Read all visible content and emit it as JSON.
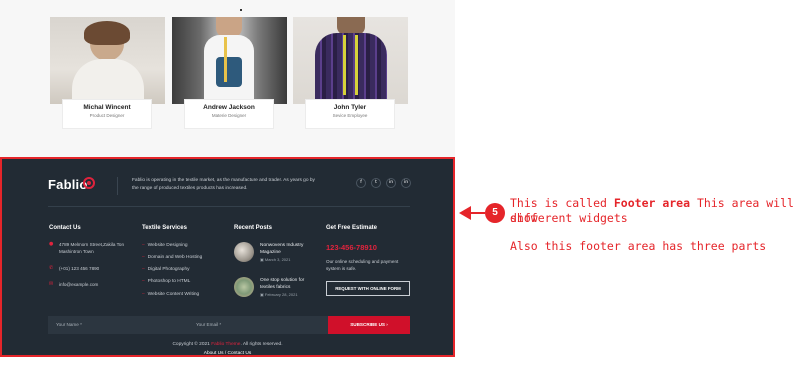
{
  "team": [
    {
      "name": "Michal Wincent",
      "role": "Product Designer"
    },
    {
      "name": "Andrew Jackson",
      "role": "Materie Designer"
    },
    {
      "name": "John Tyler",
      "role": "Sevice Employee"
    }
  ],
  "footer": {
    "logo_text": "Fablio",
    "about": "Fablio is operating in the textile market, as the manufacture and trader. As years go by the range of produced textiles products has increased.",
    "socials": [
      "f",
      "t",
      "in",
      "in"
    ],
    "contact": {
      "title": "Contact Us",
      "address": "4789 Melmorn Street,Zakila Ton Mashintron Town",
      "phone": "(+01) 123 456 7890",
      "email": "info@example.com"
    },
    "services": {
      "title": "Textile Services",
      "items": [
        "Website Designing",
        "Domain and Web Hosting",
        "Digital Photography",
        "Photoshop to HTML",
        "Website Content Writing"
      ]
    },
    "posts": {
      "title": "Recent Posts",
      "items": [
        {
          "title": "Nonwovens Industry Magazine",
          "date": "March 3, 2021"
        },
        {
          "title": "One stop solution for textiles fabrics",
          "date": "February 28, 2021"
        }
      ]
    },
    "estimate": {
      "title": "Get Free Estimate",
      "phone": "123-456-78910",
      "text": "Our online scheduling and payment system is safe.",
      "button": "REQUEST WITH ONLINE FORM"
    },
    "subscribe": {
      "name_placeholder": "Your Name *",
      "email_placeholder": "Your Email *",
      "button": "SUBSCRIBE US ›"
    },
    "copyright": {
      "prefix": "Copyright © 2021",
      "brand": "Fablio Theme",
      "suffix": ". All rights reserved."
    },
    "bottom_links": [
      "About Us",
      "Contact Us"
    ]
  },
  "annotation": {
    "badge": "5",
    "line1_prefix": "This is called",
    "line1_bold": "Footer area",
    "line1_suffix": "This area will show",
    "line2": "different widgets",
    "line3": "Also this footer area has three parts"
  },
  "colors": {
    "footer_bg": "#222b34",
    "accent": "#e0233d",
    "annotation": "#e5252a"
  }
}
